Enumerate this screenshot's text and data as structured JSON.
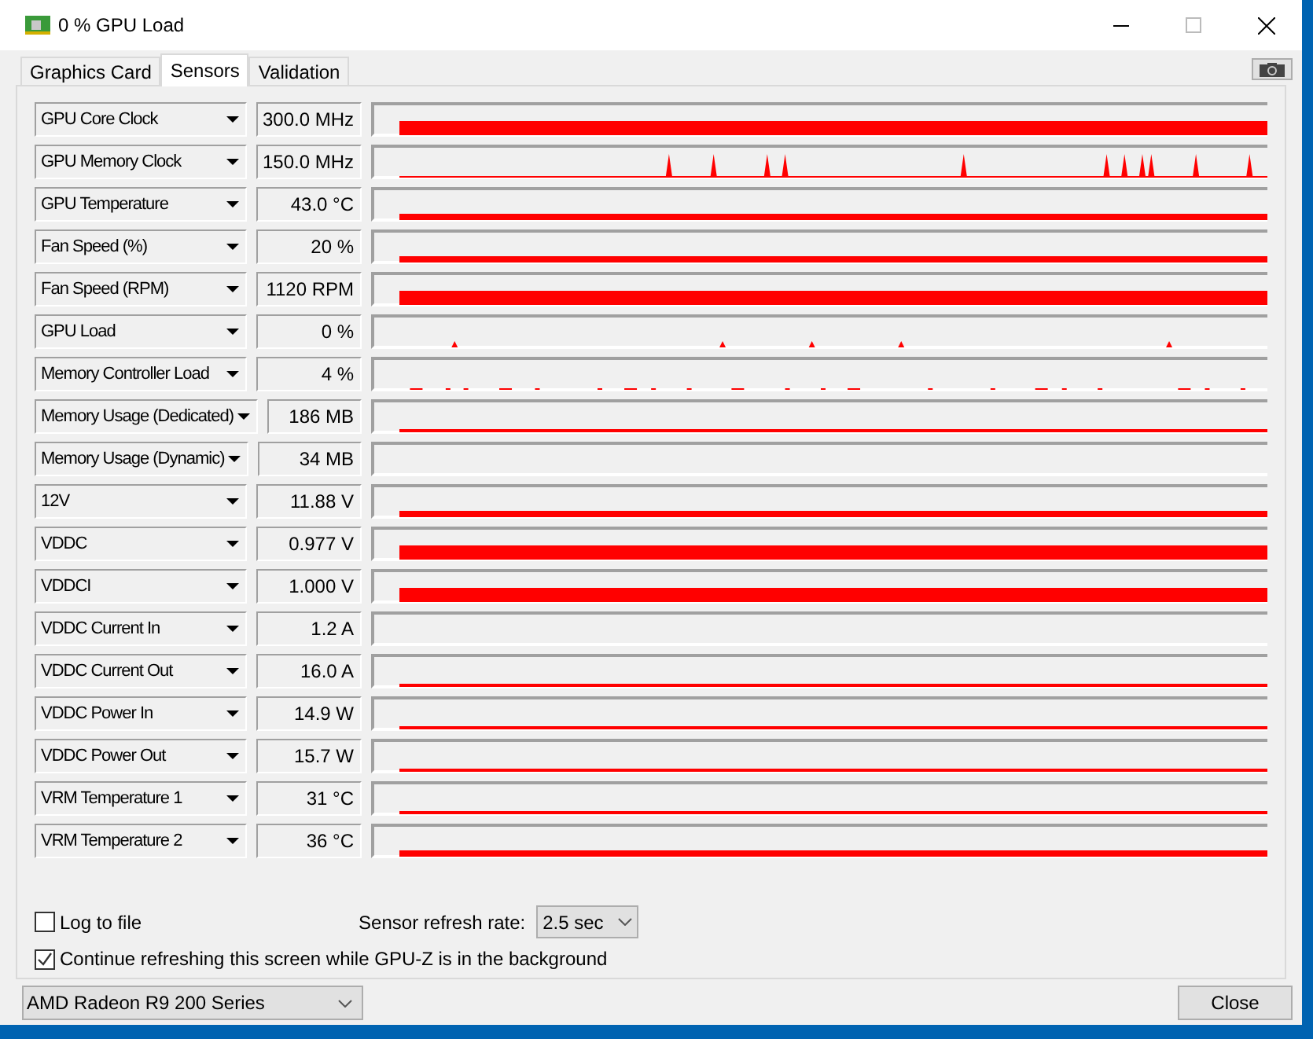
{
  "window": {
    "title": "0 % GPU Load"
  },
  "tabs": [
    {
      "label": "Graphics Card",
      "selected": false
    },
    {
      "label": "Sensors",
      "selected": true
    },
    {
      "label": "Validation",
      "selected": false
    }
  ],
  "sensors": [
    {
      "name": "GPU Core Clock",
      "value": "300.0 MHz",
      "kind": "thick"
    },
    {
      "name": "GPU Memory Clock",
      "value": "150.0 MHz",
      "kind": "spikes"
    },
    {
      "name": "GPU Temperature",
      "value": "43.0 °C",
      "kind": "band"
    },
    {
      "name": "Fan Speed (%)",
      "value": "20 %",
      "kind": "band"
    },
    {
      "name": "Fan Speed (RPM)",
      "value": "1120 RPM",
      "kind": "thick"
    },
    {
      "name": "GPU Load",
      "value": "0 %",
      "kind": "ticks"
    },
    {
      "name": "Memory Controller Load",
      "value": "4 %",
      "kind": "dots"
    },
    {
      "name": "Memory Usage (Dedicated)",
      "value": "186 MB",
      "kind": "line"
    },
    {
      "name": "Memory Usage (Dynamic)",
      "value": "34 MB",
      "kind": "empty"
    },
    {
      "name": "12V",
      "value": "11.88 V",
      "kind": "band"
    },
    {
      "name": "VDDC",
      "value": "0.977 V",
      "kind": "thick"
    },
    {
      "name": "VDDCI",
      "value": "1.000 V",
      "kind": "thick"
    },
    {
      "name": "VDDC Current In",
      "value": "1.2 A",
      "kind": "empty"
    },
    {
      "name": "VDDC Current Out",
      "value": "16.0 A",
      "kind": "line"
    },
    {
      "name": "VDDC Power In",
      "value": "14.9 W",
      "kind": "line"
    },
    {
      "name": "VDDC Power Out",
      "value": "15.7 W",
      "kind": "line"
    },
    {
      "name": "VRM Temperature 1",
      "value": "31 °C",
      "kind": "line"
    },
    {
      "name": "VRM Temperature 2",
      "value": "36 °C",
      "kind": "band"
    }
  ],
  "log_to_file": {
    "label": "Log to file",
    "checked": false
  },
  "refresh_rate": {
    "label": "Sensor refresh rate:",
    "value": "2.5 sec"
  },
  "continue_refreshing": {
    "label": "Continue refreshing this screen while GPU-Z is in the background",
    "checked": true
  },
  "gpu_select": {
    "value": "AMD Radeon R9 200 Series"
  },
  "close_button": {
    "label": "Close"
  }
}
